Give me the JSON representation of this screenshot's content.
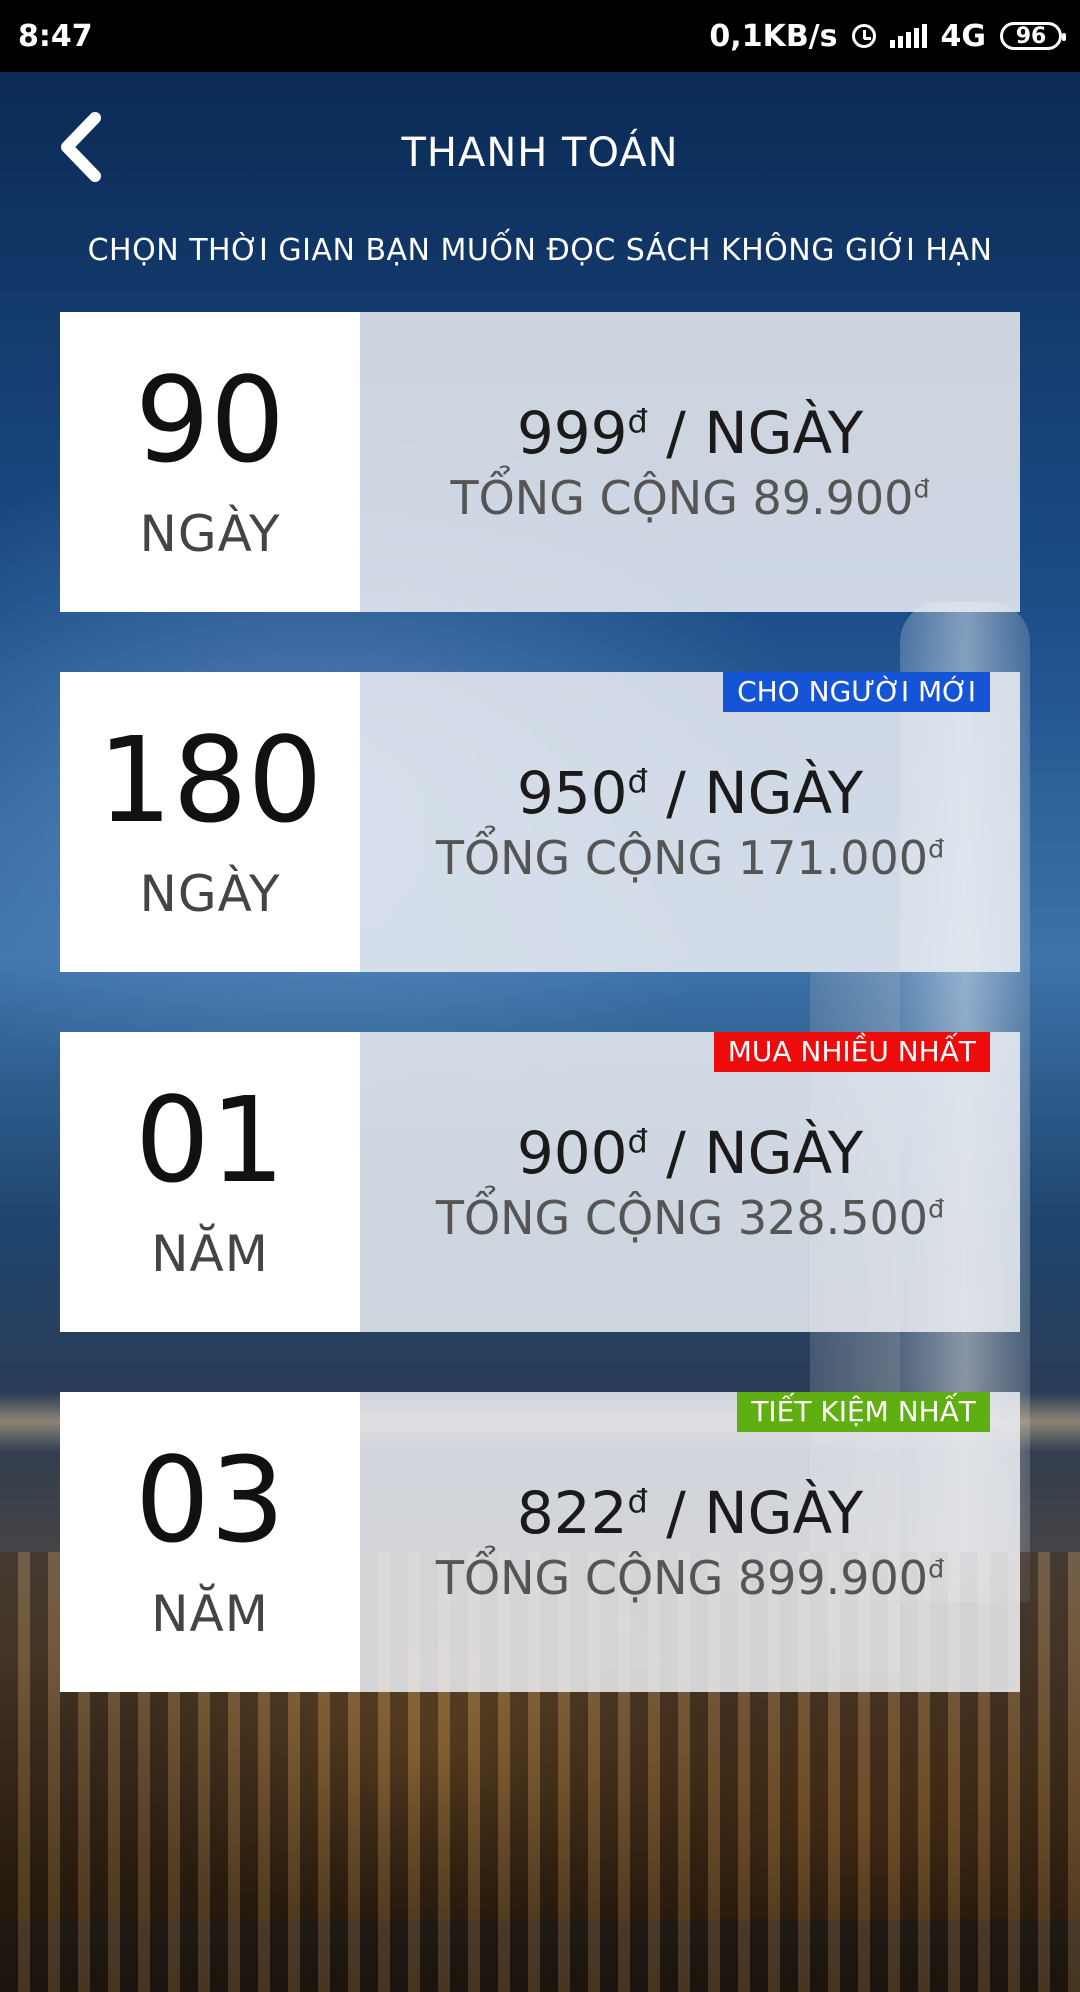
{
  "status_bar": {
    "time": "8:47",
    "net_speed": "0,1KB/s",
    "network": "4G",
    "battery": "96"
  },
  "header": {
    "title": "THANH TOÁN",
    "subtitle": "CHỌN THỜI GIAN BẠN MUỐN ĐỌC SÁCH KHÔNG GIỚI HẠN"
  },
  "plans": [
    {
      "amount": "90",
      "unit": "NGÀY",
      "price": "999",
      "per_label": " / NGÀY",
      "total_label": "TỔNG CỘNG ",
      "total": "89.900",
      "currency": "đ",
      "badge": "",
      "badge_color": ""
    },
    {
      "amount": "180",
      "unit": "NGÀY",
      "price": "950",
      "per_label": " / NGÀY",
      "total_label": "TỔNG CỘNG ",
      "total": "171.000",
      "currency": "đ",
      "badge": "CHO NGƯỜI MỚI",
      "badge_color": "#1554d6"
    },
    {
      "amount": "01",
      "unit": "NĂM",
      "price": "900",
      "per_label": " / NGÀY",
      "total_label": "TỔNG CỘNG ",
      "total": "328.500",
      "currency": "đ",
      "badge": "MUA NHIỀU NHẤT",
      "badge_color": "#ee0b0b"
    },
    {
      "amount": "03",
      "unit": "NĂM",
      "price": "822",
      "per_label": " / NGÀY",
      "total_label": "TỔNG CỘNG ",
      "total": "899.900",
      "currency": "đ",
      "badge": "TIẾT KIỆM NHẤT",
      "badge_color": "#5fae12"
    }
  ],
  "icons": {
    "back": "chevron-left-icon",
    "alarm": "alarm-icon",
    "signal": "signal-icon",
    "battery": "battery-icon"
  }
}
